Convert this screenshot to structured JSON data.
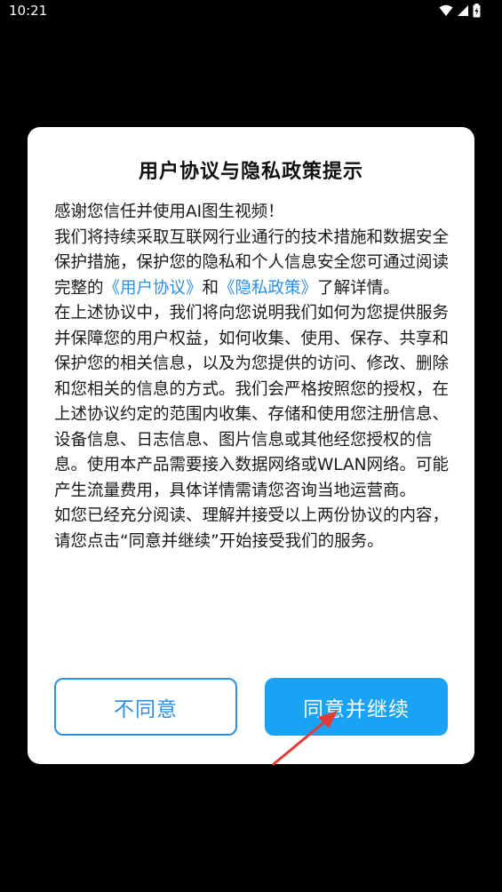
{
  "status_bar": {
    "time": "10:21",
    "icons": [
      "wifi-icon",
      "signal-icon",
      "battery-icon"
    ]
  },
  "dialog": {
    "title": "用户协议与隐私政策提示",
    "body": {
      "p1": "感谢您信任并使用AI图生视频！",
      "p2_prefix": "我们将持续采取互联网行业通行的技术措施和数据安全保护措施，保护您的隐私和个人信息安全您可通过阅读完整的",
      "link_user_agreement": "《用户协议》",
      "p2_and": "和",
      "link_privacy_policy": "《隐私政策》",
      "p2_suffix": "了解详情。",
      "p3": "在上述协议中，我们将向您说明我们如何为您提供服务并保障您的用户权益，如何收集、使用、保存、共享和保护您的相关信息，以及为您提供的访问、修改、删除和您相关的信息的方式。我们会严格按照您的授权，在上述协议约定的范围内收集、存储和使用您注册信息、设备信息、日志信息、图片信息或其他经您授权的信息。使用本产品需要接入数据网络或WLAN网络。可能产生流量费用，具体详情需请您咨询当地运营商。",
      "p4": "如您已经充分阅读、理解并接受以上两份协议的内容，请您点击“同意并继续”开始接受我们的服务。"
    },
    "buttons": {
      "disagree_label": "不同意",
      "agree_label": "同意并继续"
    }
  },
  "colors": {
    "accent": "#1aa3f5",
    "link": "#2f8fe0",
    "annotation_arrow": "#e53935"
  }
}
